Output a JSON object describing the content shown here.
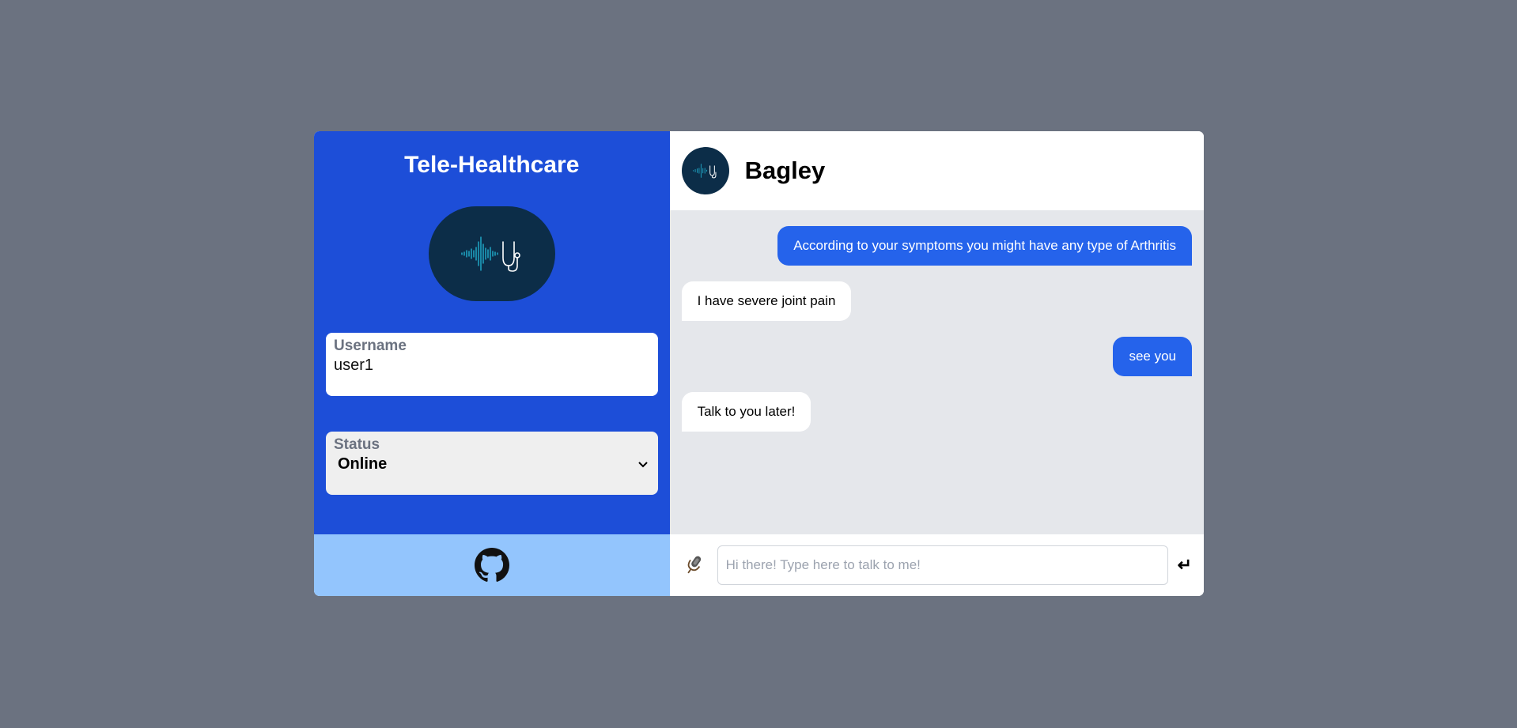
{
  "app": {
    "title": "Tele-Healthcare",
    "logo_icon": "waveform-stethoscope-icon"
  },
  "form": {
    "username": {
      "label": "Username",
      "value": "user1"
    },
    "status": {
      "label": "Status",
      "selected": "Online"
    }
  },
  "footer": {
    "icon": "github-icon"
  },
  "chat": {
    "bot_name": "Bagley",
    "messages": [
      {
        "from": "user",
        "text": "According to your symptoms you might have any type of Arthritis"
      },
      {
        "from": "bot",
        "text": "I have severe joint pain"
      },
      {
        "from": "user",
        "text": "see you"
      },
      {
        "from": "bot",
        "text": "Talk to you later!"
      }
    ],
    "input": {
      "placeholder": "Hi there! Type here to talk to me!",
      "value": ""
    },
    "send_glyph": "↵",
    "mic_icon": "microphone-icon"
  },
  "colors": {
    "background": "#6b7280",
    "panel_blue": "#1d4ed8",
    "footer_blue": "#93c5fd",
    "user_bubble": "#2563eb",
    "chat_bg": "#e5e7eb",
    "logo_bg": "#0c2d48"
  }
}
